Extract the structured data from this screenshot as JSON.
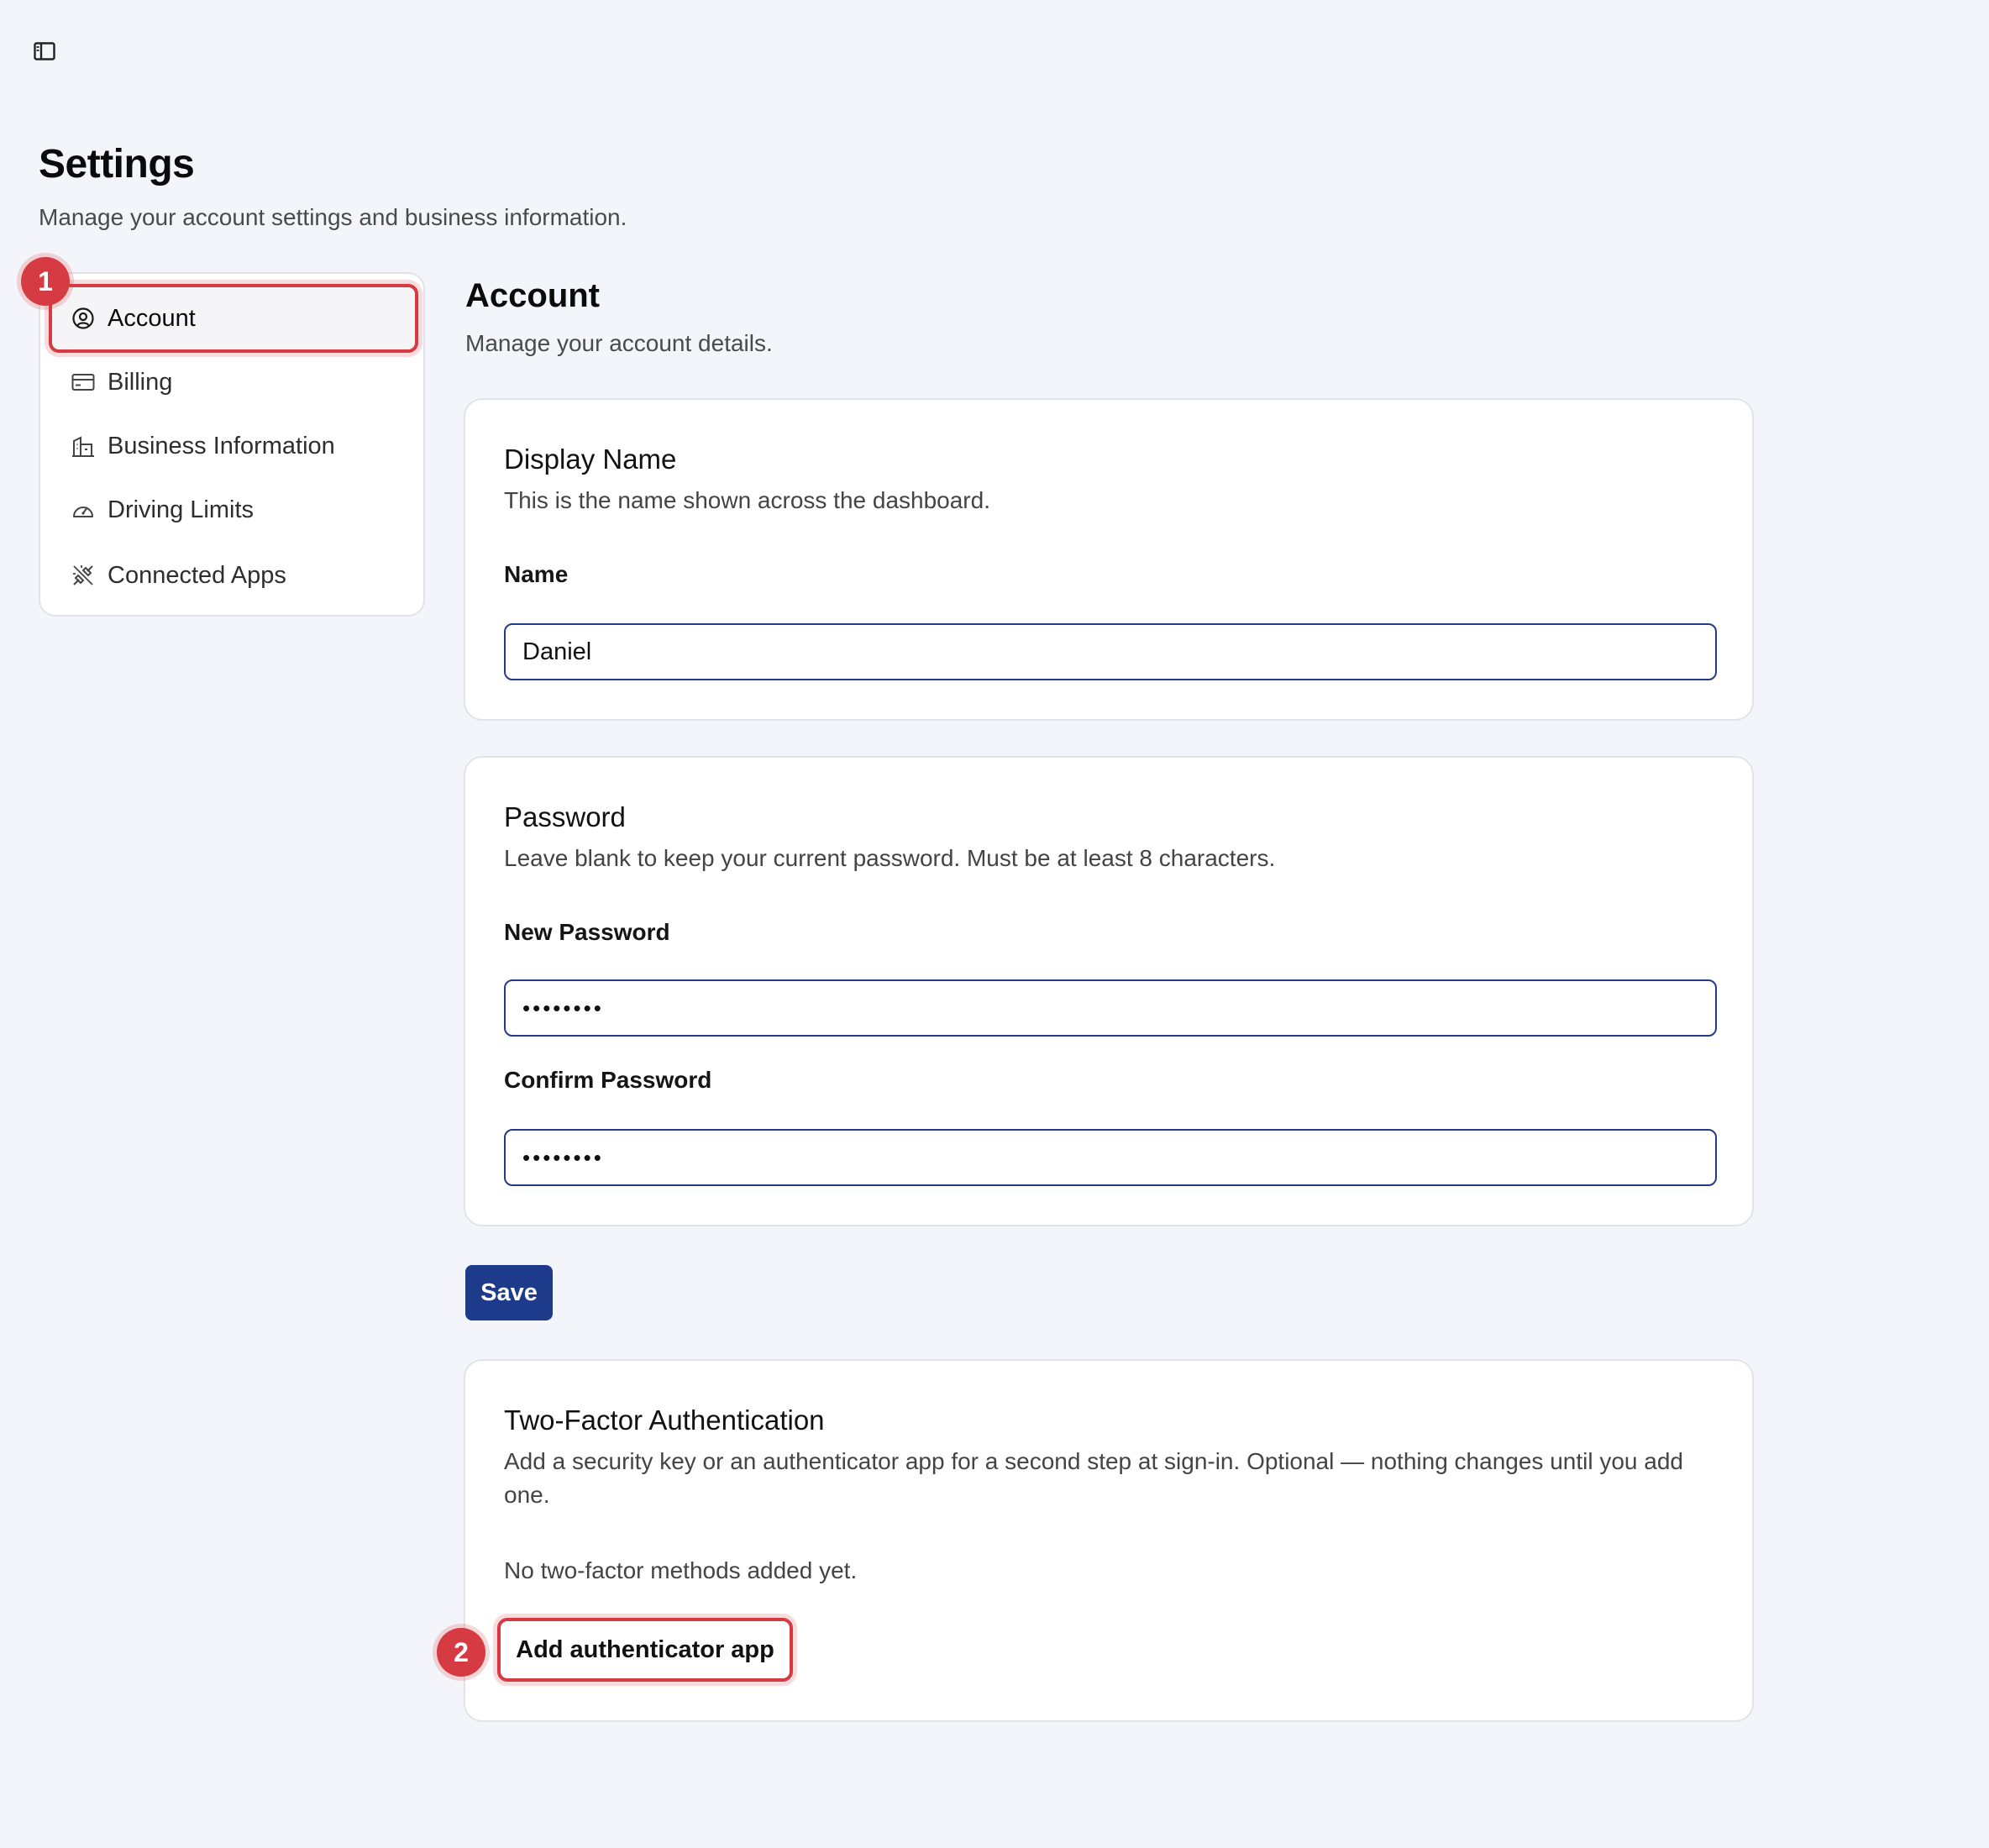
{
  "icons": {
    "sidebar_toggle": "sidebar-toggle-icon",
    "account": "user-circle-icon",
    "billing": "credit-card-icon",
    "business": "building-icon",
    "driving": "gauge-icon",
    "connected": "plug-disconnected-icon"
  },
  "header": {
    "title": "Settings",
    "subtitle": "Manage your account settings and business information."
  },
  "nav": {
    "items": [
      {
        "label": "Account",
        "active": true
      },
      {
        "label": "Billing"
      },
      {
        "label": "Business Information"
      },
      {
        "label": "Driving Limits"
      },
      {
        "label": "Connected Apps"
      }
    ]
  },
  "markers": {
    "first": "1",
    "second": "2"
  },
  "account": {
    "title": "Account",
    "subtitle": "Manage your account details."
  },
  "display_name": {
    "title": "Display Name",
    "description": "This is the name shown across the dashboard.",
    "name_label": "Name",
    "name_value": "Daniel"
  },
  "password": {
    "title": "Password",
    "description": "Leave blank to keep your current password. Must be at least 8 characters.",
    "new_label": "New Password",
    "new_value": "••••••••",
    "confirm_label": "Confirm Password",
    "confirm_value": "••••••••"
  },
  "actions": {
    "save_label": "Save"
  },
  "two_factor": {
    "title": "Two-Factor Authentication",
    "description": "Add a security key or an authenticator app for a second step at sign-in. Optional — nothing changes until you add one.",
    "empty_text": "No two-factor methods added yet.",
    "add_button_label": "Add authenticator app"
  },
  "colors": {
    "accent": "#1e3a8a",
    "highlight": "#d63a42",
    "background": "#f4f5fb"
  }
}
